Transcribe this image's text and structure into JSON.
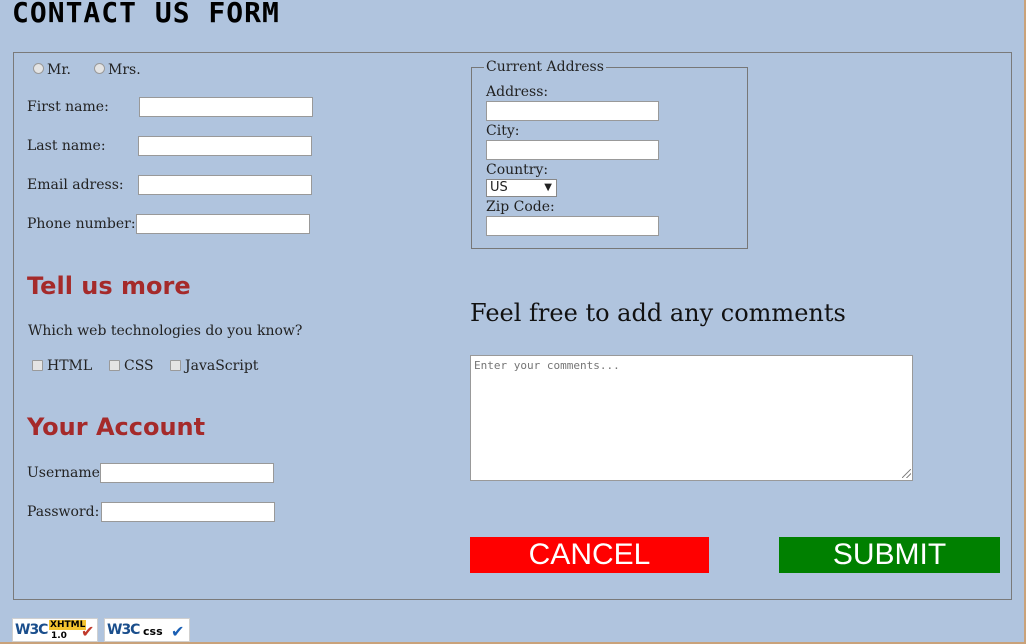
{
  "page": {
    "title": "CONTACT US FORM"
  },
  "salutation": {
    "mr": "Mr.",
    "mrs": "Mrs."
  },
  "personal": {
    "first_name_label": "First name:",
    "last_name_label": "Last name:",
    "email_label": "Email adress:",
    "phone_label": "Phone number:"
  },
  "address": {
    "legend": "Current Address",
    "address_label": "Address:",
    "city_label": "City:",
    "country_label": "Country:",
    "country_value": "US",
    "zip_label": "Zip Code:"
  },
  "tell_more": {
    "heading": "Tell us more",
    "question": "Which web technologies do you know?",
    "options": [
      "HTML",
      "CSS",
      "JavaScript"
    ]
  },
  "account": {
    "heading": "Your Account",
    "username_label": "Username:",
    "password_label": "Password:"
  },
  "comments": {
    "heading": "Feel free to add any comments",
    "placeholder": "Enter your comments..."
  },
  "buttons": {
    "cancel": "CANCEL",
    "submit": "SUBMIT"
  },
  "badges": {
    "xhtml": {
      "org": "W3C",
      "tag": "XHTML",
      "version": "1.0"
    },
    "css": {
      "org": "W3C",
      "tag": "css"
    }
  },
  "colors": {
    "background": "#b0c4de",
    "section_heading": "#a52a2a",
    "cancel": "#ff0000",
    "submit": "#008000"
  }
}
